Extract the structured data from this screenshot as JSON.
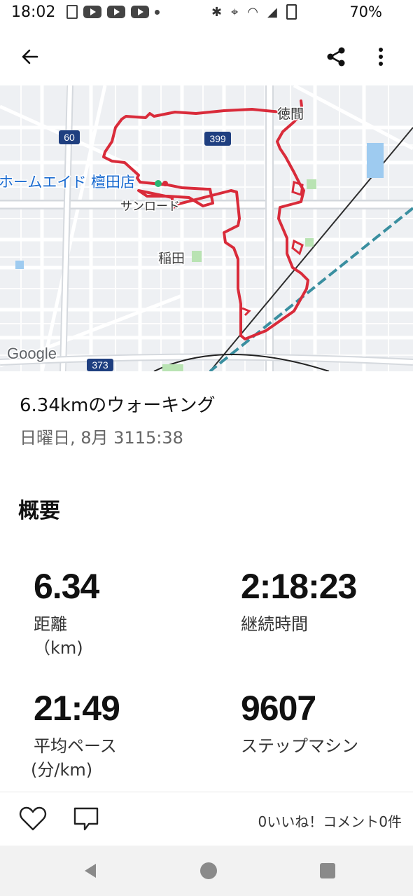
{
  "status_bar": {
    "time": "18:02",
    "battery": "70%"
  },
  "map": {
    "labels": {
      "tokuma": "徳間",
      "store": "ホームエイド 檀田店",
      "sunroad": "サンロード",
      "inada": "稲田",
      "google": "Google",
      "route_60": "60",
      "route_399": "399",
      "route_373": "373"
    },
    "route_color": "#d92b3a"
  },
  "activity": {
    "title": "6.34kmのウォーキング",
    "date": "日曜日, 8月 3115:38"
  },
  "summary": {
    "heading": "概要",
    "stats": [
      {
        "value": "6.34",
        "label": "距離",
        "unit": "（km)"
      },
      {
        "value": "2:18:23",
        "label": "継続時間",
        "unit": ""
      },
      {
        "value": "21:49",
        "label": "平均ペース",
        "unit": "(分/km)"
      },
      {
        "value": "9607",
        "label": "ステップマシン",
        "unit": ""
      }
    ]
  },
  "actions": {
    "counts": "0いいね！コメント0件"
  },
  "icons": {
    "back": "back-arrow-icon",
    "share": "share-icon",
    "more": "more-vert-icon",
    "like": "heart-icon",
    "comment": "comment-icon"
  }
}
